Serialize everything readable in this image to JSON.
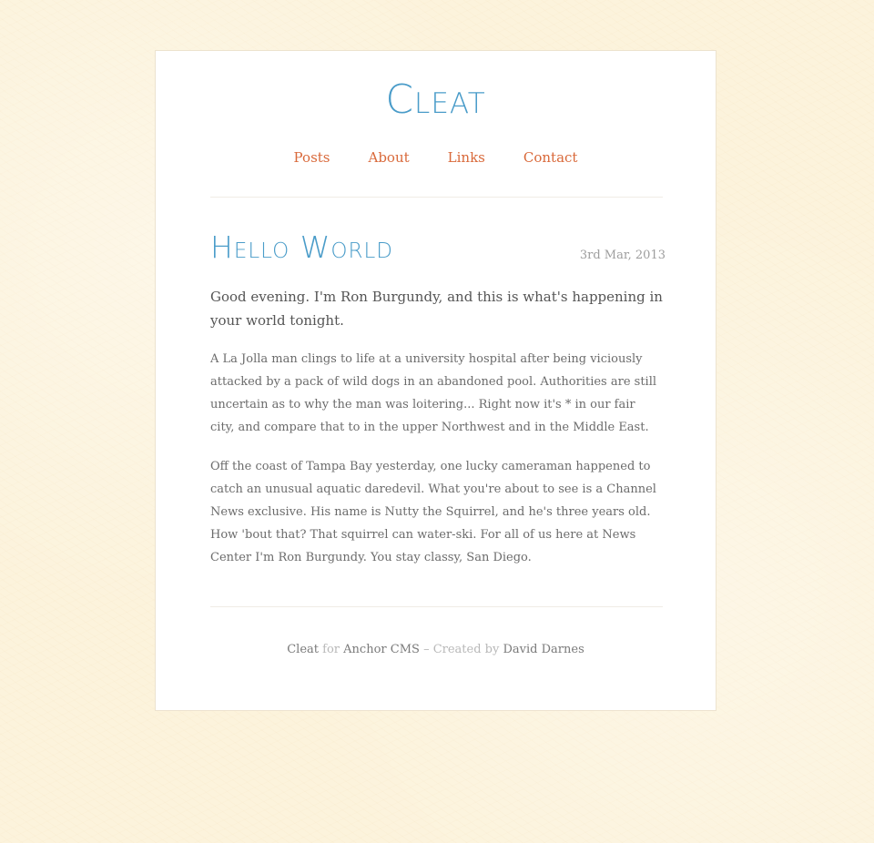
{
  "site": {
    "title": "Cleat"
  },
  "nav": {
    "items": [
      "Posts",
      "About",
      "Links",
      "Contact"
    ]
  },
  "post": {
    "title": "Hello World",
    "date": "3rd Mar, 2013",
    "lead": "Good evening. I'm Ron Burgundy, and this is what's happening in your world tonight.",
    "paragraphs": [
      "A La Jolla man clings to life at a university hospital after being viciously attacked by a pack of wild dogs in an abandoned pool. Authorities are still uncertain as to why the man was loitering... Right now it's * in our fair city, and compare that to in the upper Northwest and in the Middle East.",
      "Off the coast of Tampa Bay yesterday, one lucky cameraman happened to catch an unusual aquatic daredevil. What you're about to see is a Channel News exclusive. His name is Nutty the Squirrel, and he's three years old. How 'bout that? That squirrel can water-ski. For all of us here at News Center I'm Ron Burgundy. You stay classy, San Diego."
    ]
  },
  "footer": {
    "theme_name": "Cleat",
    "for_text": "for",
    "cms_name": "Anchor CMS",
    "created_by_text": "– Created by",
    "author_name": "David Darnes"
  },
  "colors": {
    "accent_blue": "#4a9cc9",
    "nav_orange": "#d9693a",
    "background": "#fcf3dc"
  }
}
